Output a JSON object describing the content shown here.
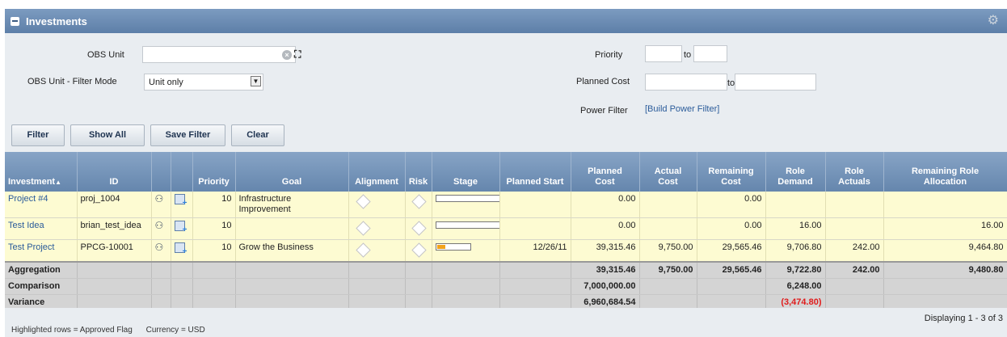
{
  "header": {
    "title": "Investments",
    "collapse_icon": "collapse-icon",
    "settings_icon": "gear-icon"
  },
  "filters": {
    "obs_unit_label": "OBS Unit",
    "obs_unit_value": "",
    "obs_mode_label": "OBS Unit - Filter Mode",
    "obs_mode_value": "Unit only",
    "priority_label": "Priority",
    "priority_from": "",
    "priority_to": "",
    "to_label": "to",
    "planned_cost_label": "Planned Cost",
    "planned_cost_from": "",
    "planned_cost_to": "",
    "power_filter_label": "Power Filter",
    "power_filter_link": "[Build Power Filter]"
  },
  "buttons": {
    "filter": "Filter",
    "show_all": "Show All",
    "save_filter": "Save Filter",
    "clear": "Clear"
  },
  "columns": {
    "investment": "Investment",
    "sort_indicator": "▲",
    "id": "ID",
    "priority": "Priority",
    "goal": "Goal",
    "alignment": "Alignment",
    "risk": "Risk",
    "stage": "Stage",
    "planned_start": "Planned Start",
    "planned_cost_1": "Planned",
    "planned_cost_2": "Cost",
    "actual_cost_1": "Actual",
    "actual_cost_2": "Cost",
    "remaining_cost_1": "Remaining",
    "remaining_cost_2": "Cost",
    "role_demand_1": "Role",
    "role_demand_2": "Demand",
    "role_actuals_1": "Role",
    "role_actuals_2": "Actuals",
    "remaining_role_1": "Remaining Role",
    "remaining_role_2": "Allocation"
  },
  "rows": [
    {
      "investment": "Project #4",
      "id": "proj_1004",
      "priority": "10",
      "goal": "Infrastructure Improvement",
      "stage_progress": 0,
      "planned_start": "",
      "planned_cost": "0.00",
      "actual_cost": "",
      "remaining_cost": "0.00",
      "role_demand": "",
      "role_actuals": "",
      "remaining_role_allocation": ""
    },
    {
      "investment": "Test Idea",
      "id": "brian_test_idea",
      "priority": "10",
      "goal": "",
      "stage_progress": 0,
      "planned_start": "",
      "planned_cost": "0.00",
      "actual_cost": "",
      "remaining_cost": "0.00",
      "role_demand": "16.00",
      "role_actuals": "",
      "remaining_role_allocation": "16.00"
    },
    {
      "investment": "Test Project",
      "id": "PPCG-10001",
      "priority": "10",
      "goal": "Grow the Business",
      "stage_progress": 0.25,
      "planned_start": "12/26/11",
      "planned_cost": "39,315.46",
      "actual_cost": "9,750.00",
      "remaining_cost": "29,565.46",
      "role_demand": "9,706.80",
      "role_actuals": "242.00",
      "remaining_role_allocation": "9,464.80"
    }
  ],
  "summary": [
    {
      "label": "Aggregation",
      "planned_cost": "39,315.46",
      "actual_cost": "9,750.00",
      "remaining_cost": "29,565.46",
      "role_demand": "9,722.80",
      "role_actuals": "242.00",
      "remaining_role_allocation": "9,480.80"
    },
    {
      "label": "Comparison",
      "planned_cost": "7,000,000.00",
      "actual_cost": "",
      "remaining_cost": "",
      "role_demand": "6,248.00",
      "role_actuals": "",
      "remaining_role_allocation": ""
    },
    {
      "label": "Variance",
      "planned_cost": "6,960,684.54",
      "actual_cost": "",
      "remaining_cost": "",
      "role_demand": "(3,474.80)",
      "role_actuals": "",
      "remaining_role_allocation": ""
    }
  ],
  "footer": {
    "displaying": "Displaying 1 - 3 of 3"
  },
  "legend": {
    "highlighted": "Highlighted rows = Approved Flag",
    "currency": "Currency = USD"
  },
  "colors": {
    "header": "#6586ad",
    "approved_row": "#fdfbd2",
    "negative": "#e01c1c",
    "stage_fill": "#f2a31b"
  }
}
